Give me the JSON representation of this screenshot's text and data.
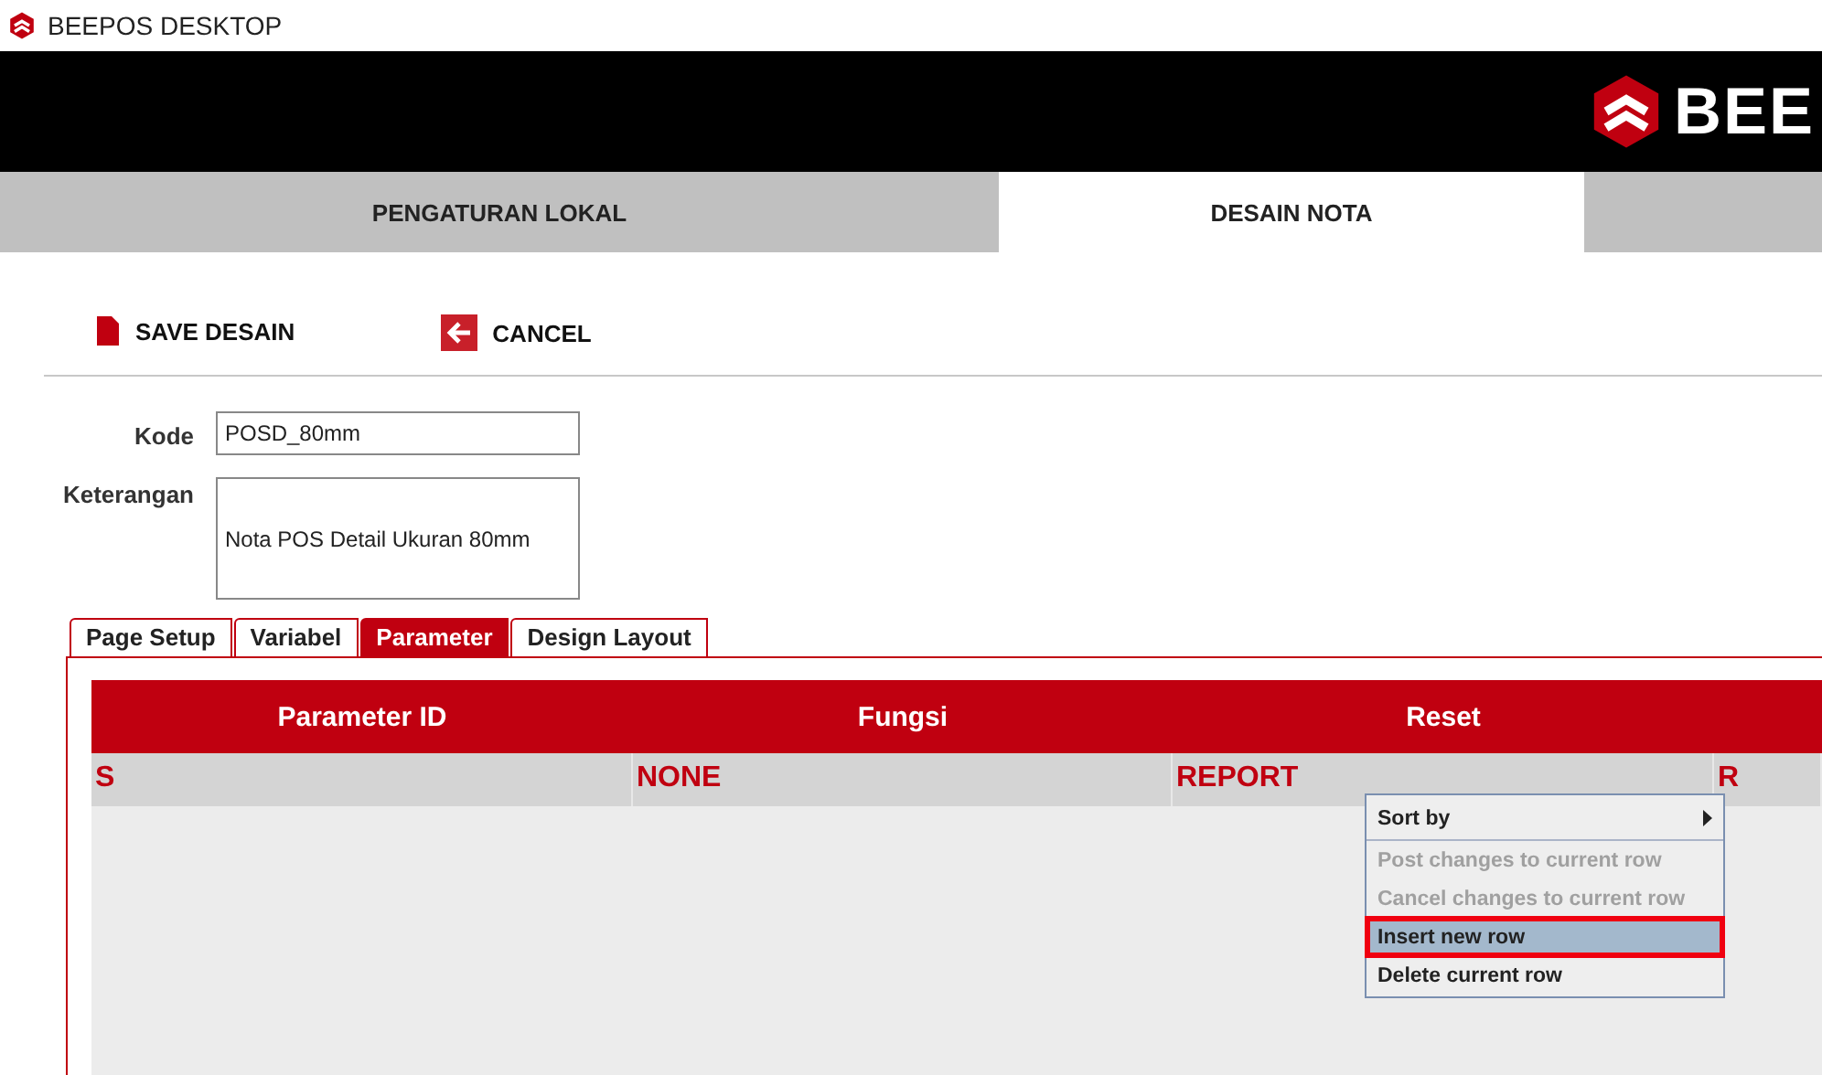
{
  "window": {
    "title": "BEEPOS DESKTOP"
  },
  "header": {
    "logo_text": "BEE"
  },
  "main_tabs": [
    {
      "label": "PENGATURAN LOKAL",
      "selected": false
    },
    {
      "label": "DESAIN NOTA",
      "selected": true
    },
    {
      "selected": false
    }
  ],
  "toolbar": [
    {
      "kind": "save",
      "label": "SAVE DESAIN"
    },
    {
      "kind": "cancel",
      "label": "CANCEL"
    }
  ],
  "form": {
    "kode_label": "Kode",
    "kode_value": "POSD_80mm",
    "keterangan_label": "Keterangan",
    "keterangan_value": "Nota POS Detail Ukuran 80mm"
  },
  "sub_tabs": [
    {
      "label": "Page Setup",
      "selected": false
    },
    {
      "label": "Variabel",
      "selected": false
    },
    {
      "label": "Parameter",
      "selected": true
    },
    {
      "label": "Design Layout",
      "selected": false
    }
  ],
  "table": {
    "columns": [
      "Parameter ID",
      "Fungsi",
      "Reset"
    ],
    "rows": [
      [
        "S",
        "NONE",
        "REPORT",
        "R"
      ]
    ]
  },
  "context_menu": [
    {
      "label": "Sort by",
      "submenu": true,
      "disabled": false,
      "selected": false
    },
    {
      "label": "Post changes to current row",
      "submenu": false,
      "disabled": true,
      "selected": false
    },
    {
      "label": "Cancel changes to current row",
      "submenu": false,
      "disabled": true,
      "selected": false
    },
    {
      "label": "Insert new row",
      "submenu": false,
      "disabled": false,
      "selected": true
    },
    {
      "label": "Delete current row",
      "submenu": false,
      "disabled": false,
      "selected": false
    }
  ]
}
